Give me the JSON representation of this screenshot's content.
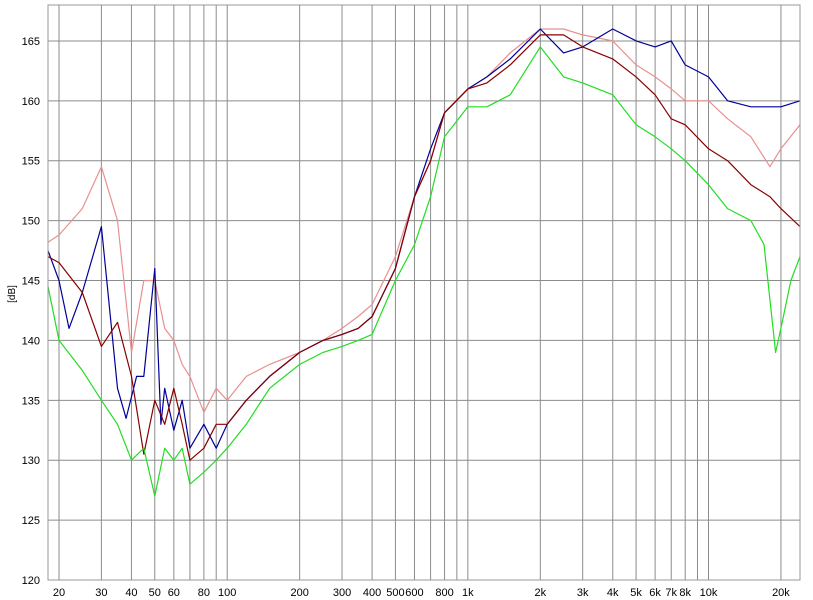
{
  "chart_data": {
    "type": "line",
    "title": "",
    "ylabel": "[dB]",
    "xlabel": "",
    "xscale": "log",
    "xlim": [
      18,
      24000
    ],
    "ylim": [
      120,
      168
    ],
    "grid": true,
    "y_ticks": [
      120,
      125,
      130,
      135,
      140,
      145,
      150,
      155,
      160,
      165
    ],
    "x_ticks": [
      {
        "value": 20,
        "label": "20"
      },
      {
        "value": 30,
        "label": "30"
      },
      {
        "value": 40,
        "label": "40"
      },
      {
        "value": 50,
        "label": "50"
      },
      {
        "value": 60,
        "label": "60"
      },
      {
        "value": 80,
        "label": "80"
      },
      {
        "value": 100,
        "label": "100"
      },
      {
        "value": 200,
        "label": "200"
      },
      {
        "value": 300,
        "label": "300"
      },
      {
        "value": 400,
        "label": "400"
      },
      {
        "value": 500,
        "label": "500"
      },
      {
        "value": 600,
        "label": "600"
      },
      {
        "value": 800,
        "label": "800"
      },
      {
        "value": 1000,
        "label": "1k"
      },
      {
        "value": 2000,
        "label": "2k"
      },
      {
        "value": 3000,
        "label": "3k"
      },
      {
        "value": 4000,
        "label": "4k"
      },
      {
        "value": 5000,
        "label": "5k"
      },
      {
        "value": 6000,
        "label": "6k"
      },
      {
        "value": 7000,
        "label": "7k"
      },
      {
        "value": 8000,
        "label": "8k"
      },
      {
        "value": 10000,
        "label": "10k"
      },
      {
        "value": 20000,
        "label": "20k"
      }
    ],
    "minor_gridlines": [
      70,
      90,
      700,
      900,
      9000
    ],
    "series": [
      {
        "color": "#e89090",
        "points": [
          [
            18,
            148.2
          ],
          [
            20,
            148.8
          ],
          [
            25,
            151
          ],
          [
            30,
            154.5
          ],
          [
            35,
            150
          ],
          [
            40,
            139
          ],
          [
            45,
            145
          ],
          [
            50,
            145
          ],
          [
            55,
            141
          ],
          [
            60,
            140
          ],
          [
            65,
            138
          ],
          [
            70,
            137
          ],
          [
            80,
            134
          ],
          [
            90,
            136
          ],
          [
            100,
            135
          ],
          [
            120,
            137
          ],
          [
            150,
            138
          ],
          [
            200,
            139
          ],
          [
            250,
            140
          ],
          [
            300,
            141
          ],
          [
            350,
            142
          ],
          [
            400,
            143
          ],
          [
            500,
            147
          ],
          [
            600,
            152
          ],
          [
            700,
            155
          ],
          [
            800,
            159
          ],
          [
            1000,
            161
          ],
          [
            1200,
            162
          ],
          [
            1500,
            164
          ],
          [
            2000,
            166
          ],
          [
            2500,
            166
          ],
          [
            3000,
            165.5
          ],
          [
            4000,
            165
          ],
          [
            5000,
            163
          ],
          [
            6000,
            162
          ],
          [
            7000,
            161
          ],
          [
            8000,
            160
          ],
          [
            10000,
            160
          ],
          [
            12000,
            158.5
          ],
          [
            15000,
            157
          ],
          [
            18000,
            154.5
          ],
          [
            20000,
            156
          ],
          [
            24000,
            158
          ]
        ]
      },
      {
        "color": "#000099",
        "points": [
          [
            18,
            147.5
          ],
          [
            20,
            145
          ],
          [
            22,
            141
          ],
          [
            25,
            144
          ],
          [
            30,
            149.5
          ],
          [
            35,
            136
          ],
          [
            38,
            133.5
          ],
          [
            42,
            137
          ],
          [
            45,
            137
          ],
          [
            50,
            146
          ],
          [
            53,
            133
          ],
          [
            55,
            136
          ],
          [
            60,
            132.5
          ],
          [
            65,
            135
          ],
          [
            70,
            131
          ],
          [
            80,
            133
          ],
          [
            90,
            131
          ],
          [
            100,
            133
          ],
          [
            120,
            135
          ],
          [
            150,
            137
          ],
          [
            200,
            139
          ],
          [
            250,
            140
          ],
          [
            300,
            140.5
          ],
          [
            350,
            141
          ],
          [
            400,
            142
          ],
          [
            500,
            146
          ],
          [
            600,
            152
          ],
          [
            700,
            156
          ],
          [
            800,
            159
          ],
          [
            1000,
            161
          ],
          [
            1200,
            162
          ],
          [
            1500,
            163.5
          ],
          [
            2000,
            166
          ],
          [
            2500,
            164
          ],
          [
            3000,
            164.5
          ],
          [
            4000,
            166
          ],
          [
            5000,
            165
          ],
          [
            6000,
            164.5
          ],
          [
            7000,
            165
          ],
          [
            8000,
            163
          ],
          [
            10000,
            162
          ],
          [
            12000,
            160
          ],
          [
            15000,
            159.5
          ],
          [
            20000,
            159.5
          ],
          [
            24000,
            160
          ]
        ]
      },
      {
        "color": "#880000",
        "points": [
          [
            18,
            147
          ],
          [
            20,
            146.5
          ],
          [
            25,
            144
          ],
          [
            30,
            139.5
          ],
          [
            35,
            141.5
          ],
          [
            40,
            137
          ],
          [
            45,
            130.5
          ],
          [
            50,
            135
          ],
          [
            55,
            133
          ],
          [
            60,
            136
          ],
          [
            65,
            133
          ],
          [
            70,
            130
          ],
          [
            80,
            131
          ],
          [
            90,
            133
          ],
          [
            100,
            133
          ],
          [
            120,
            135
          ],
          [
            150,
            137
          ],
          [
            200,
            139
          ],
          [
            250,
            140
          ],
          [
            300,
            140.5
          ],
          [
            350,
            141
          ],
          [
            400,
            142
          ],
          [
            500,
            146
          ],
          [
            600,
            152
          ],
          [
            700,
            155
          ],
          [
            800,
            159
          ],
          [
            1000,
            161
          ],
          [
            1200,
            161.5
          ],
          [
            1500,
            163
          ],
          [
            2000,
            165.5
          ],
          [
            2500,
            165.5
          ],
          [
            3000,
            164.5
          ],
          [
            4000,
            163.5
          ],
          [
            5000,
            162
          ],
          [
            6000,
            160.5
          ],
          [
            7000,
            158.5
          ],
          [
            8000,
            158
          ],
          [
            10000,
            156
          ],
          [
            12000,
            155
          ],
          [
            15000,
            153
          ],
          [
            18000,
            152
          ],
          [
            20000,
            151
          ],
          [
            24000,
            149.5
          ]
        ]
      },
      {
        "color": "#22dd22",
        "points": [
          [
            18,
            144.5
          ],
          [
            20,
            140
          ],
          [
            25,
            137.5
          ],
          [
            30,
            135
          ],
          [
            35,
            133
          ],
          [
            40,
            130
          ],
          [
            45,
            131
          ],
          [
            50,
            127
          ],
          [
            55,
            131
          ],
          [
            60,
            130
          ],
          [
            65,
            131
          ],
          [
            70,
            128
          ],
          [
            80,
            129
          ],
          [
            90,
            130
          ],
          [
            100,
            131
          ],
          [
            120,
            133
          ],
          [
            150,
            136
          ],
          [
            200,
            138
          ],
          [
            250,
            139
          ],
          [
            300,
            139.5
          ],
          [
            350,
            140
          ],
          [
            400,
            140.5
          ],
          [
            500,
            145
          ],
          [
            600,
            148
          ],
          [
            700,
            152
          ],
          [
            800,
            157
          ],
          [
            1000,
            159.5
          ],
          [
            1200,
            159.5
          ],
          [
            1500,
            160.5
          ],
          [
            2000,
            164.5
          ],
          [
            2500,
            162
          ],
          [
            3000,
            161.5
          ],
          [
            4000,
            160.5
          ],
          [
            5000,
            158
          ],
          [
            6000,
            157
          ],
          [
            7000,
            156
          ],
          [
            8000,
            155
          ],
          [
            10000,
            153
          ],
          [
            12000,
            151
          ],
          [
            15000,
            150
          ],
          [
            17000,
            148
          ],
          [
            19000,
            139
          ],
          [
            20000,
            141
          ],
          [
            22000,
            145
          ],
          [
            24000,
            147
          ]
        ]
      }
    ]
  }
}
